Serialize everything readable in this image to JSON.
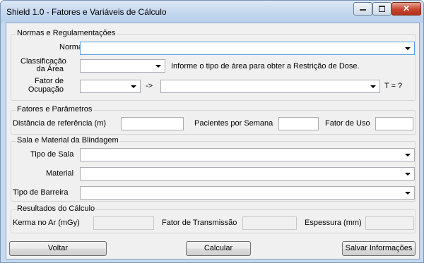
{
  "window": {
    "title": "Shield 1.0 - Fatores e Variáveis de Cálculo",
    "min_icon": "minimize-icon",
    "max_icon": "maximize-icon",
    "close_icon": "close-icon",
    "close_glyph": "✕",
    "max_glyph": "□",
    "min_glyph": "−"
  },
  "normas": {
    "legend": "Normas e Regulamentações",
    "norma_label": "Norma",
    "classificacao_label_1": "Classificação",
    "classificacao_label_2": "da Área",
    "classificacao_hint": "Informe o tipo de área para obter a Restrição de Dose.",
    "fator_label_1": "Fator de",
    "fator_label_2": "Ocupação",
    "arrow_text": "->",
    "t_text": "T = ?"
  },
  "fatores": {
    "legend": "Fatores e Parâmetros",
    "distancia_label": "Distância de referência (m)",
    "pacientes_label": "Pacientes por Semana",
    "fator_uso_label": "Fator de Uso"
  },
  "sala": {
    "legend": "Sala e Material da Blindagem",
    "tipo_sala_label": "Tipo de Sala",
    "material_label": "Material",
    "tipo_barreira_label": "Tipo de Barreira"
  },
  "resultados": {
    "legend": "Resultados do Cálculo",
    "kerma_label": "Kerma no Ar (mGy)",
    "transmissao_label": "Fator de Transmissão",
    "espessura_label": "Espessura (mm)"
  },
  "buttons": {
    "voltar": "Voltar",
    "calcular": "Calcular",
    "salvar": "Salvar Informações"
  },
  "colors": {
    "frame": "#c6d9ef",
    "client": "#f0f0f0",
    "close": "#c7452d",
    "focus": "#569de5"
  }
}
